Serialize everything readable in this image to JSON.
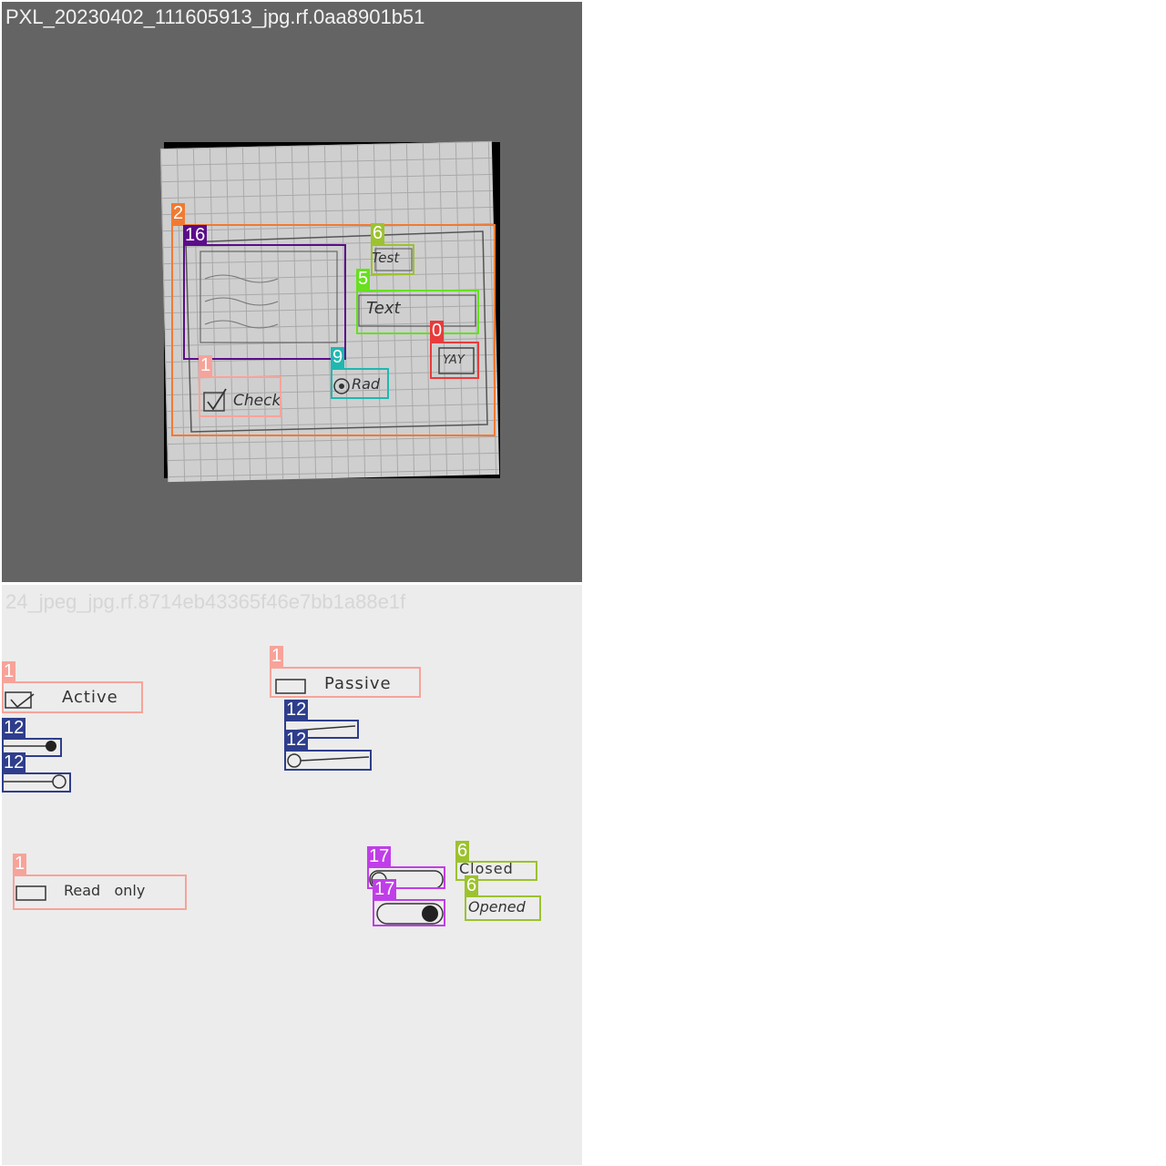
{
  "tiles": [
    {
      "title": "PXL_20230402_111605913_jpg.rf.0aa8901b51",
      "sketch_text": {
        "test": "Test",
        "text": "Text",
        "yay": "YAY",
        "check": "Check",
        "rad": "Rad"
      },
      "detections": [
        {
          "label": "2",
          "color": "#f07a32"
        },
        {
          "label": "16",
          "color": "#5a0d8a"
        },
        {
          "label": "6",
          "color": "#9cc22e"
        },
        {
          "label": "5",
          "color": "#66e01f"
        },
        {
          "label": "0",
          "color": "#e83b3b"
        },
        {
          "label": "9",
          "color": "#1fb8b0"
        },
        {
          "label": "1",
          "color": "#f7a39a"
        }
      ]
    },
    {
      "title": "24_jpeg_jpg.rf.8714eb43365f46e7bb1a88e1f",
      "sketch_text": {
        "active": "Active",
        "passive": "Passive",
        "read_only": "Read   only",
        "closed": "Closed",
        "opened": "Opened"
      },
      "detections": [
        {
          "label": "1",
          "color": "#f7a39a"
        },
        {
          "label": "1",
          "color": "#f7a39a"
        },
        {
          "label": "12",
          "color": "#2e3e8c"
        },
        {
          "label": "12",
          "color": "#2e3e8c"
        },
        {
          "label": "12",
          "color": "#2e3e8c"
        },
        {
          "label": "12",
          "color": "#2e3e8c"
        },
        {
          "label": "1",
          "color": "#f7a39a"
        },
        {
          "label": "17",
          "color": "#c03ee8"
        },
        {
          "label": "17",
          "color": "#c03ee8"
        },
        {
          "label": "6",
          "color": "#9cc22e"
        },
        {
          "label": "6",
          "color": "#9cc22e"
        }
      ]
    }
  ]
}
